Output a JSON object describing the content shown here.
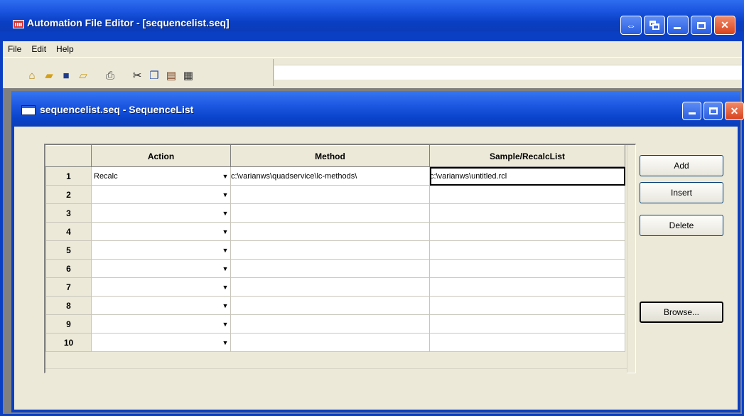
{
  "app": {
    "title": "Automation File Editor - [sequencelist.seq]"
  },
  "menu": [
    "File",
    "Edit",
    "Help"
  ],
  "toolbar_icons": [
    "home-icon",
    "open-folder-icon",
    "save-icon",
    "open-file-icon",
    "print-icon",
    "cut-icon",
    "copy-icon",
    "paste-icon",
    "properties-icon"
  ],
  "child": {
    "title": "sequencelist.seq - SequenceList"
  },
  "grid": {
    "headers": {
      "action": "Action",
      "method": "Method",
      "sample": "Sample/RecalcList"
    },
    "rows": [
      {
        "num": "1",
        "action": "Recalc",
        "method": "c:\\varianws\\quadservice\\lc-methods\\",
        "sample": "c:\\varianws\\untitled.rcl"
      },
      {
        "num": "2",
        "action": "",
        "method": "",
        "sample": ""
      },
      {
        "num": "3",
        "action": "",
        "method": "",
        "sample": ""
      },
      {
        "num": "4",
        "action": "",
        "method": "",
        "sample": ""
      },
      {
        "num": "5",
        "action": "",
        "method": "",
        "sample": ""
      },
      {
        "num": "6",
        "action": "",
        "method": "",
        "sample": ""
      },
      {
        "num": "7",
        "action": "",
        "method": "",
        "sample": ""
      },
      {
        "num": "8",
        "action": "",
        "method": "",
        "sample": ""
      },
      {
        "num": "9",
        "action": "",
        "method": "",
        "sample": ""
      },
      {
        "num": "10",
        "action": "",
        "method": "",
        "sample": ""
      }
    ]
  },
  "buttons": {
    "add": "Add",
    "insert": "Insert",
    "delete": "Delete",
    "browse": "Browse..."
  }
}
